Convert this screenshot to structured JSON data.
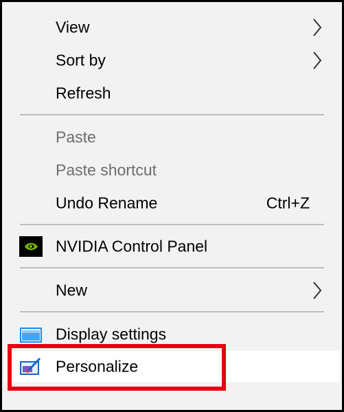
{
  "menu": {
    "items": [
      {
        "label": "View",
        "submenu": true
      },
      {
        "label": "Sort by",
        "submenu": true
      },
      {
        "label": "Refresh"
      },
      {
        "label": "Paste",
        "disabled": true
      },
      {
        "label": "Paste shortcut",
        "disabled": true
      },
      {
        "label": "Undo Rename",
        "shortcut": "Ctrl+Z"
      },
      {
        "label": "NVIDIA Control Panel",
        "icon": "nvidia-icon"
      },
      {
        "label": "New",
        "submenu": true
      },
      {
        "label": "Display settings",
        "icon": "display-icon"
      },
      {
        "label": "Personalize",
        "icon": "personalize-icon",
        "highlighted": true
      }
    ]
  },
  "colors": {
    "highlight_border": "#e60012",
    "separator": "#bdbdbd",
    "disabled_text": "#6d6d6d"
  }
}
